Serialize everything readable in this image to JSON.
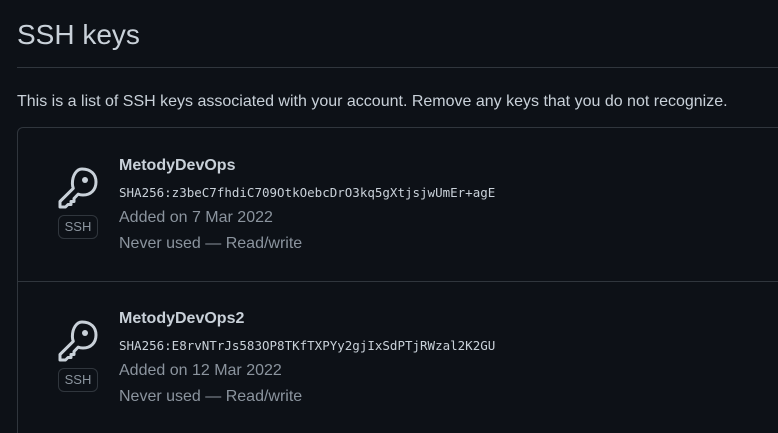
{
  "page": {
    "title": "SSH keys",
    "description": "This is a list of SSH keys associated with your account. Remove any keys that you do not recognize."
  },
  "keys": [
    {
      "name": "MetodyDevOps",
      "fingerprint": "SHA256:z3beC7fhdiC709OtkOebcDrO3kq5gXtjsjwUmEr+agE",
      "added": "Added on 7 Mar 2022",
      "usage": "Never used — Read/write",
      "badge": "SSH",
      "icon": "key-icon"
    },
    {
      "name": "MetodyDevOps2",
      "fingerprint": "SHA256:E8rvNTrJs583OP8TKfTXPYy2gjIxSdPTjRWzal2K2GU",
      "added": "Added on 12 Mar 2022",
      "usage": "Never used — Read/write",
      "badge": "SSH",
      "icon": "key-icon"
    }
  ],
  "colors": {
    "background": "#0d1117",
    "text": "#c9d1d9",
    "muted": "#8b949e",
    "border": "#30363d"
  }
}
